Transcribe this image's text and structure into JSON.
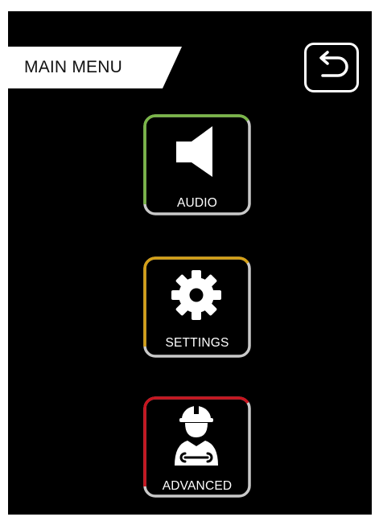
{
  "header": {
    "title": "MAIN MENU",
    "back_icon": "undo-arrow-icon"
  },
  "menu": {
    "items": [
      {
        "label": "AUDIO",
        "icon": "speaker-icon",
        "accent": "#7ab648"
      },
      {
        "label": "SETTINGS",
        "icon": "gear-icon",
        "accent": "#d4a017"
      },
      {
        "label": "ADVANCED",
        "icon": "technician-icon",
        "accent": "#c8141e"
      }
    ]
  },
  "colors": {
    "background": "#000000",
    "tile_border_neutral": "#c9c9c9",
    "text": "#ffffff"
  }
}
